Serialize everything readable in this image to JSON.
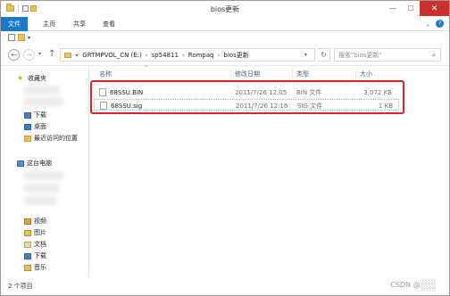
{
  "window": {
    "title": "bios更新",
    "minimize": "—",
    "maximize": "☐",
    "close": "✕"
  },
  "ribbon": {
    "tabs": [
      "文件",
      "主页",
      "共享",
      "查看"
    ]
  },
  "nav": {
    "back": "←",
    "forward": "→",
    "up": "↑",
    "breadcrumb": [
      "«",
      "GRTMPVOL_CN (E:)",
      "sp54811",
      "Rompaq",
      "bios更新"
    ],
    "separator": "›",
    "search_placeholder": "搜索\"bios更新\""
  },
  "sidebar": {
    "favorites": "收藏夹",
    "fav_items": [
      "下载",
      "桌面",
      "最近访问的位置"
    ],
    "this_pc": "这台电脑",
    "pc_items": [
      "视频",
      "图片",
      "文档",
      "下载",
      "音乐"
    ]
  },
  "columns": {
    "name": "名称",
    "date": "修改日期",
    "type": "类型",
    "size": "大小"
  },
  "files": [
    {
      "name": "68SSU.BIN",
      "date": "2011/7/26 12:05",
      "type": "BIN 文件",
      "size": "3,072 KB"
    },
    {
      "name": "68SSU.sig",
      "date": "2011/7/26 12:16",
      "type": "SIG 文件",
      "size": "1 KB"
    }
  ],
  "status": {
    "item_count": "2 个项目",
    "watermark": "CSDN @░░░"
  },
  "colors": {
    "accent": "#1979ca",
    "highlight": "#d9252a"
  }
}
